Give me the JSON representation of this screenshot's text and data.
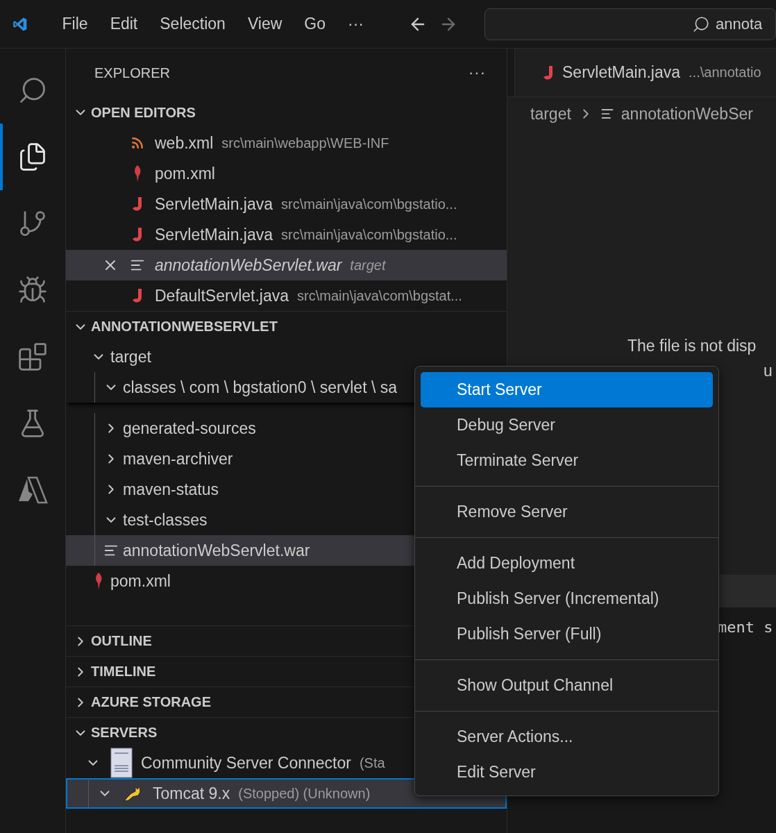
{
  "menu_bar": {
    "items": [
      "File",
      "Edit",
      "Selection",
      "View",
      "Go",
      "···"
    ],
    "search": {
      "value": "annota"
    }
  },
  "activity_bar": {
    "items": [
      {
        "kind": "search",
        "selected": false
      },
      {
        "kind": "explorer",
        "selected": true
      },
      {
        "kind": "source-control",
        "selected": false
      },
      {
        "kind": "run-debug",
        "selected": false
      },
      {
        "kind": "extensions",
        "selected": false
      },
      {
        "kind": "testing",
        "selected": false
      },
      {
        "kind": "azure",
        "selected": false
      }
    ]
  },
  "sidebar": {
    "title": "EXPLORER",
    "more": "···",
    "open_editors": {
      "title": "OPEN EDITORS",
      "expanded": true,
      "items": [
        {
          "name": "web.xml",
          "path": "src\\main\\webapp\\WEB-INF",
          "kind": "xml",
          "preview": false,
          "selected": false
        },
        {
          "name": "pom.xml",
          "kind": "maven",
          "preview": false,
          "selected": false
        },
        {
          "name": "ServletMain.java",
          "path": "src\\main\\java\\com\\bgstatio...",
          "kind": "java",
          "preview": false,
          "selected": false
        },
        {
          "name": "ServletMain.java",
          "path": "src\\main\\java\\com\\bgstatio...",
          "kind": "java",
          "preview": false,
          "selected": false
        },
        {
          "name": "annotationWebServlet.war",
          "path": "target",
          "kind": "binary",
          "preview": true,
          "selected": true
        },
        {
          "name": "DefaultServlet.java",
          "path": "src\\main\\java\\com\\bgstat...",
          "kind": "java",
          "preview": false,
          "selected": false
        }
      ]
    },
    "project": {
      "title": "ANNOTATIONWEBSERVLET",
      "expanded": true,
      "tree": [
        {
          "name": "target",
          "kind": "folder",
          "expanded": true,
          "selected": false,
          "children": [
            {
              "name": "classes \\ com \\ bgstation0 \\ servlet \\ sa",
              "kind": "sticky-folder",
              "expanded": true
            },
            {
              "name": "generated-sources",
              "kind": "folder",
              "expanded": false,
              "selected": false
            },
            {
              "name": "maven-archiver",
              "kind": "folder",
              "expanded": false,
              "selected": false
            },
            {
              "name": "maven-status",
              "kind": "folder",
              "expanded": false,
              "selected": false
            },
            {
              "name": "test-classes",
              "kind": "folder",
              "expanded": true,
              "selected": false
            },
            {
              "name": "annotationWebServlet.war",
              "kind": "binary",
              "selected": true
            }
          ]
        },
        {
          "name": "pom.xml",
          "kind": "maven",
          "selected": false
        }
      ]
    },
    "sections": [
      {
        "title": "OUTLINE",
        "expanded": false
      },
      {
        "title": "TIMELINE",
        "expanded": false
      },
      {
        "title": "AZURE STORAGE",
        "expanded": false
      }
    ],
    "servers": {
      "title": "SERVERS",
      "expanded": true,
      "items": [
        {
          "name": "Community Server Connector",
          "status": "(Sta",
          "kind": "connector",
          "expanded": true,
          "selected": false
        },
        {
          "name": "Tomcat 9.x",
          "status": "(Stopped) (Unknown)",
          "kind": "tomcat",
          "expanded": true,
          "selected": true
        }
      ]
    }
  },
  "editor": {
    "tab": {
      "name": "ServletMain.java",
      "path": "...\\annotatio",
      "kind": "java"
    },
    "breadcrumb": [
      "target",
      "annotationWebSer"
    ],
    "message_lines": [
      "The file is not disp",
      "u"
    ],
    "panel": {
      "text": "ment s"
    }
  },
  "context_menu": {
    "groups": [
      [
        {
          "label": "Start Server",
          "selected": true
        },
        {
          "label": "Debug Server",
          "selected": false
        },
        {
          "label": "Terminate Server",
          "selected": false
        }
      ],
      [
        {
          "label": "Remove Server",
          "selected": false
        }
      ],
      [
        {
          "label": "Add Deployment",
          "selected": false
        },
        {
          "label": "Publish Server (Incremental)",
          "selected": false
        },
        {
          "label": "Publish Server (Full)",
          "selected": false
        }
      ],
      [
        {
          "label": "Show Output Channel",
          "selected": false
        }
      ],
      [
        {
          "label": "Server Actions...",
          "selected": false
        },
        {
          "label": "Edit Server",
          "selected": false
        }
      ]
    ]
  }
}
